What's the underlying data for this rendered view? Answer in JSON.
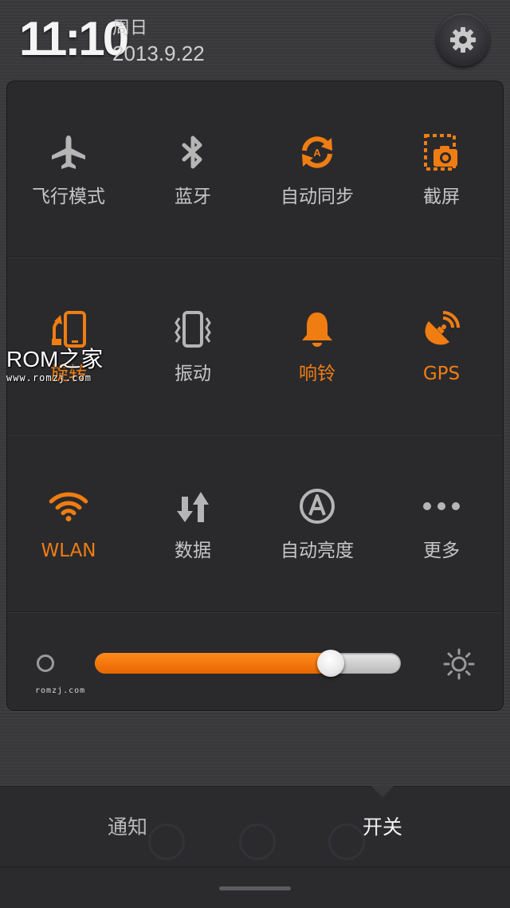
{
  "status": {
    "time": "11:10",
    "weekday": "周日",
    "date": "2013.9.22"
  },
  "settings": {
    "icon": "gear-icon"
  },
  "toggles": [
    {
      "label": "飞行模式",
      "icon": "airplane-icon",
      "on": false
    },
    {
      "label": "蓝牙",
      "icon": "bluetooth-icon",
      "on": false
    },
    {
      "label": "自动同步",
      "icon": "sync-icon",
      "on": false
    },
    {
      "label": "截屏",
      "icon": "screenshot-icon",
      "on": false
    },
    {
      "label": "旋转",
      "icon": "rotate-icon",
      "on": true
    },
    {
      "label": "振动",
      "icon": "vibrate-icon",
      "on": false
    },
    {
      "label": "响铃",
      "icon": "bell-icon",
      "on": true
    },
    {
      "label": "GPS",
      "icon": "gps-icon",
      "on": true
    },
    {
      "label": "WLAN",
      "icon": "wifi-icon",
      "on": true
    },
    {
      "label": "数据",
      "icon": "data-icon",
      "on": false
    },
    {
      "label": "自动亮度",
      "icon": "auto-brightness-icon",
      "on": false
    },
    {
      "label": "更多",
      "icon": "more-icon",
      "on": false
    }
  ],
  "brightness": {
    "level": 0.77
  },
  "watermark": {
    "logo": "ROM之家",
    "url": "www.romzj.com",
    "small": "romzj.com"
  },
  "tabs": {
    "notifications": "通知",
    "toggles": "开关"
  },
  "colors": {
    "accent": "#f07d12",
    "inactive_icon": "#b5b5b5",
    "panel": "#2a2a2d"
  }
}
